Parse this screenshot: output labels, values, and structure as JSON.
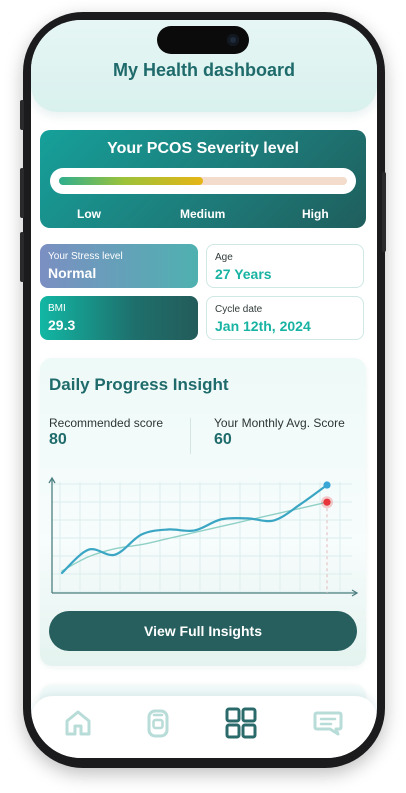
{
  "header": {
    "title": "My Health dashboard"
  },
  "severity": {
    "title": "Your PCOS Severity level",
    "level_fraction": 0.5,
    "labels": {
      "low": "Low",
      "medium": "Medium",
      "high": "High"
    }
  },
  "cards": {
    "stress": {
      "label": "Your Stress level",
      "value": "Normal"
    },
    "age": {
      "label": "Age",
      "value": "27 Years"
    },
    "bmi": {
      "label": "BMI",
      "value": "29.3"
    },
    "cycle": {
      "label": "Cycle date",
      "value": "Jan 12th, 2024"
    }
  },
  "progress": {
    "title": "Daily Progress Insight",
    "recommended": {
      "label": "Recommended score",
      "value": "80"
    },
    "monthly": {
      "label": "Your Monthly Avg. Score",
      "value": "60"
    },
    "button_label": "View Full Insights"
  },
  "chart_data": {
    "type": "line",
    "title": "",
    "xlabel": "",
    "ylabel": "",
    "grid": true,
    "x": [
      0,
      1,
      2,
      3,
      4,
      5,
      6,
      7,
      8,
      9,
      10
    ],
    "ylim": [
      0,
      100
    ],
    "series": [
      {
        "color": "#3aa6c4",
        "values": [
          10,
          33,
          28,
          48,
          53,
          52,
          63,
          64,
          62,
          78,
          97
        ]
      },
      {
        "color": "#8fd0c6",
        "values": [
          12,
          26,
          34,
          38,
          44,
          50,
          56,
          62,
          68,
          74,
          80
        ]
      }
    ],
    "markers": [
      {
        "series": 0,
        "index": 10,
        "color": "#3aa6d6"
      },
      {
        "series": 1,
        "index": 10,
        "color": "#e8353b"
      }
    ]
  },
  "nav": {
    "items": [
      {
        "icon": "home-icon",
        "active": false
      },
      {
        "icon": "tracker-icon",
        "active": false
      },
      {
        "icon": "dashboard-icon",
        "active": true
      },
      {
        "icon": "chat-icon",
        "active": false
      }
    ],
    "colors": {
      "active": "#2b6a6a",
      "inactive": "#b8dcd8"
    }
  }
}
